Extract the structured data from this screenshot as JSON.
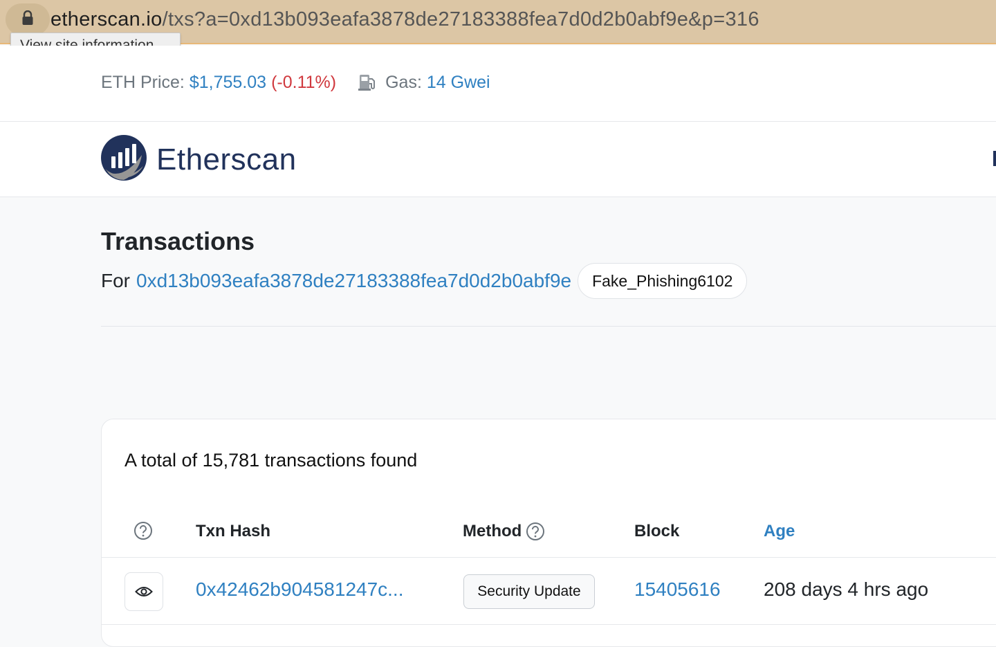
{
  "browser": {
    "tooltip": "View site information",
    "url_host": "etherscan.io",
    "url_path": "/txs?a=0xd13b093eafa3878de27183388fea7d0d2b0abf9e&p=316"
  },
  "info_strip": {
    "eth_price_label": "ETH Price:",
    "eth_price_value": "$1,755.03",
    "eth_price_change": "(-0.11%)",
    "gas_label": "Gas:",
    "gas_value": "14 Gwei"
  },
  "header": {
    "logo_text": "Etherscan"
  },
  "page": {
    "title": "Transactions",
    "for_label": "For",
    "address": "0xd13b093eafa3878de27183388fea7d0d2b0abf9e",
    "name_tag": "Fake_Phishing6102"
  },
  "table": {
    "total_text": "A total of 15,781 transactions found",
    "columns": {
      "txn_hash": "Txn Hash",
      "method": "Method",
      "block": "Block",
      "age": "Age"
    },
    "rows": [
      {
        "txn_hash": "0x42462b904581247c...",
        "method": "Security Update",
        "block": "15405616",
        "age": "208 days 4 hrs ago"
      }
    ]
  },
  "colors": {
    "link": "#2f80c1",
    "negative": "#d0393e",
    "brand_dark": "#21325b",
    "address_bar": "#dcc6a5"
  },
  "icons": {
    "lock": "lock-icon",
    "gas": "gas-pump-icon",
    "help": "question-circle-icon",
    "eye": "eye-icon",
    "logo": "etherscan-logo-icon"
  }
}
